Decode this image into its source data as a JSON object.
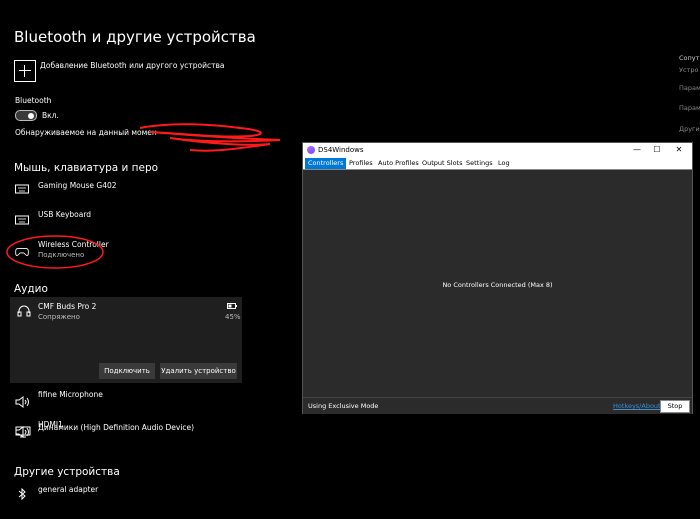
{
  "settings": {
    "title": "Bluetooth и другие устройства",
    "add_device_label": "Добавление Bluetooth или другого устройства",
    "bluetooth_label": "Bluetooth",
    "bluetooth_state": "Вкл.",
    "discoverable_text": "Обнаруживаемое на данный момен",
    "mouse_section": "Мышь, клавиатура и перо",
    "devices": [
      {
        "name": "Gaming Mouse G402",
        "status": "",
        "icon": "keyboard-icon"
      },
      {
        "name": "USB Keyboard",
        "status": "",
        "icon": "keyboard-icon"
      },
      {
        "name": "Wireless Controller",
        "status": "Подключено",
        "icon": "gamepad-icon"
      }
    ],
    "audio_section": "Аудио",
    "audio_selected": {
      "name": "CMF Buds Pro 2",
      "status": "Сопряжено",
      "battery": "45%",
      "connect_btn": "Подключить",
      "remove_btn": "Удалить устройство"
    },
    "audio_devices": [
      {
        "name": "fifine Microphone",
        "icon": "speaker-icon"
      },
      {
        "name": "HDMI1",
        "icon": "monitor-icon"
      },
      {
        "name": "Динамики (High Definition Audio Device)",
        "icon": "speaker-icon"
      }
    ],
    "other_section": "Другие устройства",
    "other_devices": [
      {
        "name": "general adapter",
        "icon": "bluetooth-icon"
      }
    ],
    "right_column": [
      "Сопут",
      "Устро",
      "Парам",
      "Парам",
      "Другие"
    ]
  },
  "ds4": {
    "title": "DS4Windows",
    "tabs": [
      "Controllers",
      "Profiles",
      "Auto Profiles",
      "Output Slots",
      "Settings",
      "Log"
    ],
    "active_tab": "Controllers",
    "message": "No Controllers Connected (Max 8)",
    "status_mode": "Using Exclusive Mode",
    "hotkeys_link": "Hotkeys/About",
    "stop_btn": "Stop"
  },
  "colors": {
    "accent": "#0078d7",
    "scribble": "#ff1a1a"
  }
}
